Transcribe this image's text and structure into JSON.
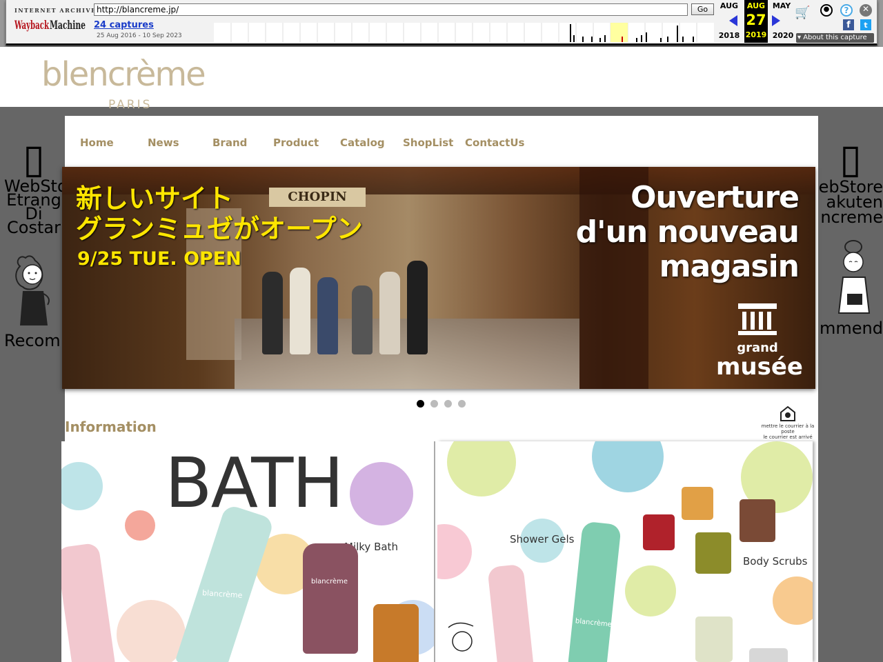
{
  "wayback": {
    "logo_small": "INTERNET ARCHIVE",
    "logo_text": "WaybackMachine",
    "url": "http://blancreme.jp/",
    "go_label": "Go",
    "captures_link": "24 captures",
    "date_range": "25 Aug 2016 - 10 Sep 2023",
    "prev_month": "AUG",
    "prev_year": "2018",
    "current_month": "AUG",
    "current_day": "27",
    "current_year": "2019",
    "next_month": "MAY",
    "next_year": "2020",
    "about_label": "About this capture"
  },
  "brand": {
    "name": "blencrème",
    "subtitle": "PARIS"
  },
  "nav": {
    "items": [
      {
        "label": "Home"
      },
      {
        "label": "News"
      },
      {
        "label": "Brand"
      },
      {
        "label": "Product"
      },
      {
        "label": "Catalog"
      },
      {
        "label": "ShopList"
      },
      {
        "label": "ContactUs"
      }
    ]
  },
  "left_side": {
    "line1": "WebSto",
    "line2": "Etrang",
    "line3": "Di",
    "line4": "Costar",
    "recommend": "Recom"
  },
  "right_side": {
    "line1": "ebStore",
    "line2": "akuten",
    "line3": "ncreme",
    "recommend": "mmend"
  },
  "hero": {
    "jp_line1": "新しいサイト",
    "jp_line2": "グランミュゼがオープン",
    "date_text": "9/25 TUE. OPEN",
    "fr_line1": "Ouverture",
    "fr_line2": "d'un nouveau",
    "fr_line3": "magasin",
    "gm_name1": "grand",
    "gm_name2": "musée",
    "shop_sign": "CHOPIN"
  },
  "slider": {
    "dot_count": 4,
    "active_index": 0
  },
  "information": {
    "title": "Information",
    "post_line1": "mettre le courrier à la poste",
    "post_line2": "le courrier est arrivé"
  },
  "panels": {
    "bath_title": "BATH",
    "milky_bath": "Milky Bath",
    "shower_gels": "Shower Gels",
    "body_scrubs": "Body Scrubs",
    "bottle_brand": "blancrème"
  },
  "colors": {
    "nav_text": "#a48f63",
    "brand_logo": "#c8b99a",
    "page_bg": "#666666",
    "wayback_highlight": "#ffff00"
  }
}
